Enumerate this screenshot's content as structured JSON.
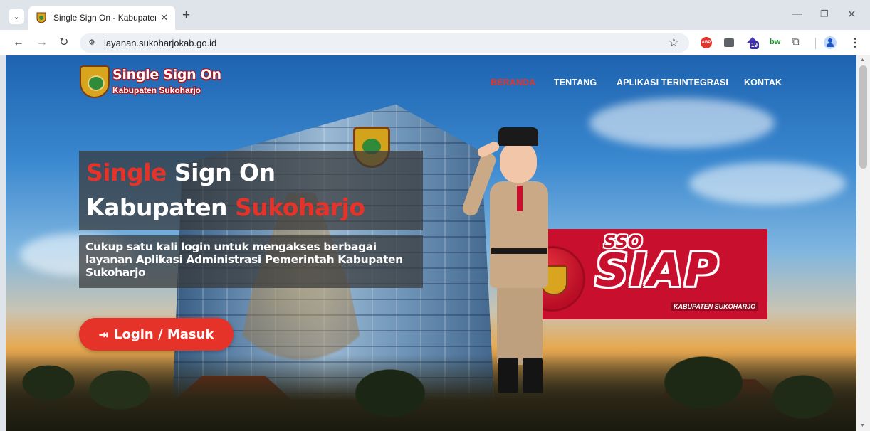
{
  "browser": {
    "tab_title": "Single Sign On - Kabupaten Sukoharjo",
    "url": "layanan.sukoharjokab.go.id",
    "new_tab_glyph": "+",
    "close_glyph": "✕",
    "extensions": {
      "abp_label": "ABP",
      "home_badge": "19",
      "bw_label": "bw"
    },
    "icons": [
      "tab-list-icon",
      "back-icon",
      "forward-icon",
      "reload-icon",
      "site-info-icon",
      "bookmark-star-icon",
      "puzzle-icon",
      "profile-icon",
      "menu-icon",
      "minimize-icon",
      "restore-icon",
      "close-icon"
    ]
  },
  "site": {
    "logo_title": "Single Sign On",
    "logo_subtitle": "Kabupaten Sukoharjo",
    "nav": [
      {
        "label": "BERANDA",
        "active": true
      },
      {
        "label": "TENTANG",
        "active": false
      },
      {
        "label": "APLIKASI TERINTEGRASI",
        "active": false
      },
      {
        "label": "KONTAK",
        "active": false
      }
    ],
    "hero": {
      "line1_accent": "Single",
      "line1_rest": " Sign On",
      "line2_rest": "Kabupaten ",
      "line2_accent": "Sukoharjo",
      "description": "Cukup satu kali login untuk mengakses berbagai layanan Aplikasi Administrasi Pemerintah Kabupaten Sukoharjo",
      "login_label": "Login / Masuk"
    },
    "banner": {
      "sso": "SSO",
      "siap": "SIAP",
      "subtitle": "KABUPATEN SUKOHARJO"
    },
    "colors": {
      "accent_red": "#e6332a",
      "banner_red": "#c8102e"
    }
  }
}
